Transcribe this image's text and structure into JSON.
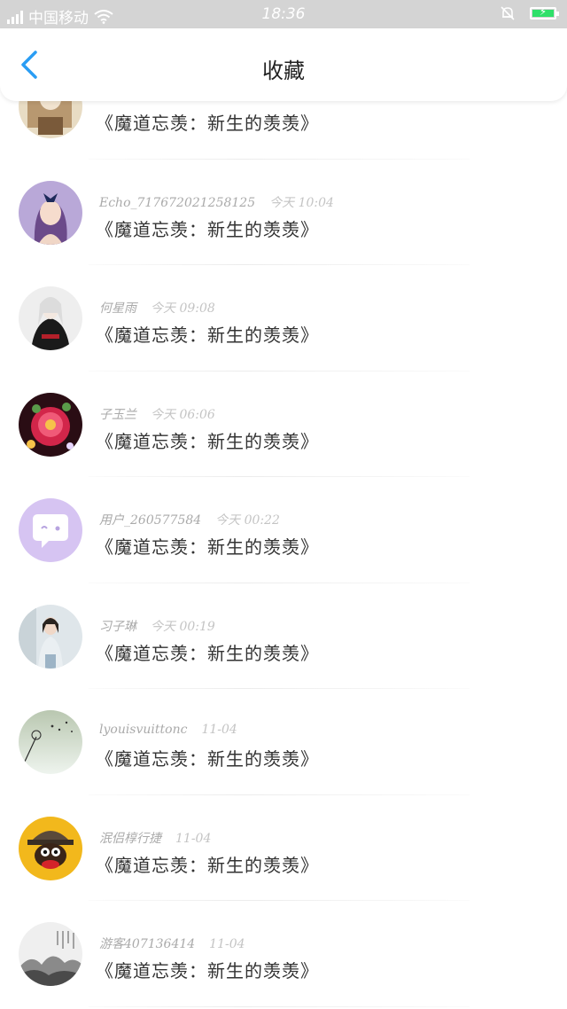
{
  "status_bar": {
    "carrier": "中国移动",
    "time": "18:36"
  },
  "header": {
    "title": "收藏"
  },
  "items": [
    {
      "username": "",
      "time": "",
      "title": "《魔道忘羡：新生的羡羡》",
      "avatar": "avatar-ancient"
    },
    {
      "username": "Echo_717672021258125",
      "time": "今天 10:04",
      "title": "《魔道忘羡：新生的羡羡》",
      "avatar": "avatar-anime-girl"
    },
    {
      "username": "何星雨",
      "time": "今天 09:08",
      "title": "《魔道忘羡：新生的羡羡》",
      "avatar": "avatar-black-robe"
    },
    {
      "username": "子玉兰",
      "time": "今天 06:06",
      "title": "《魔道忘羡：新生的羡羡》",
      "avatar": "avatar-peony"
    },
    {
      "username": "用户_260577584",
      "time": "今天 00:22",
      "title": "《魔道忘羡：新生的羡羡》",
      "avatar": "avatar-default-chat"
    },
    {
      "username": "习子琳",
      "time": "今天 00:19",
      "title": "《魔道忘羡：新生的羡羡》",
      "avatar": "avatar-photo-girl"
    },
    {
      "username": "lyouisvuittonc",
      "time": "11-04",
      "title": "《魔道忘羡：新生的羡羡》",
      "avatar": "avatar-dandelion"
    },
    {
      "username": "泯侣椁行捷",
      "time": "11-04",
      "title": "《魔道忘羡：新生的羡羡》",
      "avatar": "avatar-monkey"
    },
    {
      "username": "游客407136414",
      "time": "11-04",
      "title": "《魔道忘羡：新生的羡羡》",
      "avatar": "avatar-ink-landscape"
    }
  ],
  "colors": {
    "accent": "#2a9df4",
    "status_bar_bg": "#d4d4d4",
    "battery": "#2fe06a"
  }
}
